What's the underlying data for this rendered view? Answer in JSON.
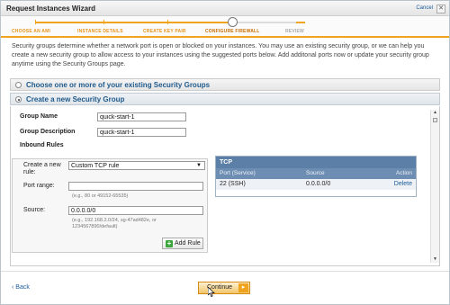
{
  "window": {
    "title": "Request Instances Wizard",
    "cancel_label": "Cancel",
    "close_glyph": "✕"
  },
  "steps": [
    {
      "label": "CHOOSE AN AMI",
      "state": "done"
    },
    {
      "label": "INSTANCE DETAILS",
      "state": "done"
    },
    {
      "label": "CREATE KEY PAIR",
      "state": "done"
    },
    {
      "label": "CONFIGURE FIREWALL",
      "state": "current"
    },
    {
      "label": "REVIEW",
      "state": "pending"
    }
  ],
  "intro_text": "Security groups determine whether a network port is open or blocked on your instances. You may use an existing security group, or we can help you create a new security group to allow access to your instances using the suggested ports below. Add additonal ports now or update your security group anytime using the Security Groups page.",
  "options": {
    "existing_label": "Choose one or more of your existing Security Groups",
    "create_label": "Create a new Security Group"
  },
  "form": {
    "group_name_label": "Group Name",
    "group_name_value": "quick-start-1",
    "group_description_label": "Group Description",
    "group_description_value": "quick-start-1",
    "inbound_rules_label": "Inbound Rules"
  },
  "rule_editor": {
    "create_new_rule_label": "Create a new rule:",
    "rule_type_value": "Custom TCP rule",
    "port_range_label": "Port range:",
    "port_range_value": "",
    "port_range_hint": "(e.g., 80 or 49152-65535)",
    "source_label": "Source:",
    "source_value": "0.0.0.0/0",
    "source_hint_line1": "(e.g., 192.168.2.0/24, sg-47ad482e, or",
    "source_hint_line2": "1234567890/default)",
    "add_rule_label": "Add Rule"
  },
  "tcp_table": {
    "title": "TCP",
    "columns": [
      "Port (Service)",
      "Source",
      "Action"
    ],
    "rows": [
      {
        "port": "22 (SSH)",
        "source": "0.0.0.0/0",
        "action": "Delete"
      }
    ]
  },
  "footer": {
    "back_label": "‹ Back",
    "continue_label": "Continue",
    "continue_arrow": "▸"
  },
  "colors": {
    "accent_orange": "#f0a31c",
    "link_blue": "#1a5a99",
    "table_header": "#5b7fa6"
  }
}
